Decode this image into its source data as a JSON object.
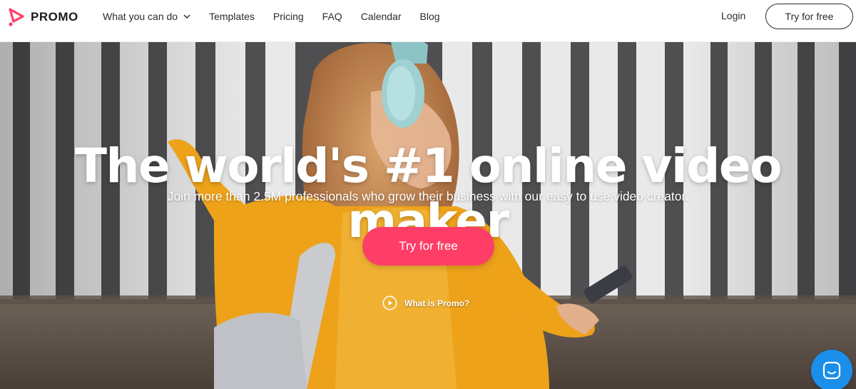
{
  "brand": {
    "name": "PROMO",
    "logo_icon": "promo-play-logo",
    "accent_color": "#ff3e68"
  },
  "nav": {
    "items": [
      {
        "label": "What you can do",
        "has_dropdown": true
      },
      {
        "label": "Templates"
      },
      {
        "label": "Pricing"
      },
      {
        "label": "FAQ"
      },
      {
        "label": "Calendar"
      },
      {
        "label": "Blog"
      }
    ],
    "login_label": "Login",
    "try_label": "Try for free"
  },
  "hero": {
    "title": "The world's #1 online video maker",
    "subtitle": "Join more than 2.5M professionals who grow their business with our easy to use video creator.",
    "cta_label": "Try for free",
    "video_link_label": "What is Promo?"
  },
  "chat": {
    "icon": "chat-icon",
    "color": "#1a8ee8"
  }
}
